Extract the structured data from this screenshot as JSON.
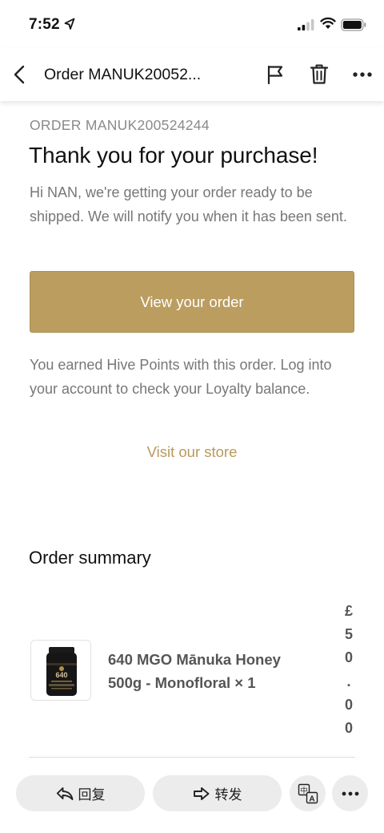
{
  "status_bar": {
    "time": "7:52"
  },
  "nav": {
    "title": "Order MANUK20052..."
  },
  "email": {
    "order_number": "ORDER MANUK200524244",
    "headline": "Thank you for your purchase!",
    "intro": "Hi NAN, we're getting your order ready to be shipped. We will notify you when it has been sent.",
    "view_order_label": "View your order",
    "loyalty_text": "You earned Hive Points with this order. Log into your account to check your Loyalty balance.",
    "visit_store_label": "Visit our store",
    "summary_title": "Order summary",
    "items": [
      {
        "name": "640 MGO Mānuka Honey 500g - Monofloral × 1",
        "price_chars": [
          "£",
          "5",
          "0",
          ".",
          "0",
          "0"
        ]
      }
    ]
  },
  "bottom_bar": {
    "reply_label": "回复",
    "forward_label": "转发"
  },
  "colors": {
    "accent_gold": "#bb9d5f",
    "link_gold": "#b9995b",
    "muted_text": "#777777"
  },
  "icons": [
    "location-arrow-icon",
    "signal-icon",
    "wifi-icon",
    "battery-icon",
    "back-chevron-icon",
    "flag-icon",
    "trash-icon",
    "more-icon",
    "reply-icon",
    "forward-icon",
    "translate-icon"
  ]
}
